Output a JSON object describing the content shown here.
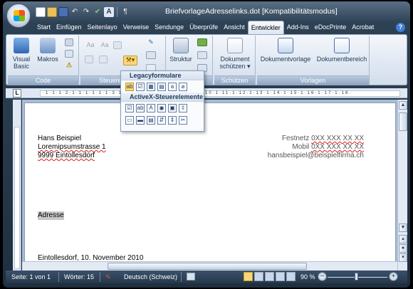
{
  "window": {
    "title": "BriefvorlageAdresselinks.dot [Kompatibilitätsmodus]"
  },
  "quick_access": {
    "icons": [
      "new-document-icon",
      "open-folder-icon",
      "save-icon",
      "undo-icon",
      "redo-icon",
      "check-mark-icon",
      "font-icon",
      "paragraph-marks-icon"
    ],
    "undo_glyph": "↶",
    "redo_glyph": "↷",
    "paragraph_glyph": "¶"
  },
  "ribbon_tabs": [
    "Start",
    "Einfügen",
    "Seitenlayo",
    "Verweise",
    "Sendunge",
    "Überprüfe",
    "Ansicht",
    "Entwickler",
    "Add-Ins",
    "eDocPrinte",
    "Acrobat"
  ],
  "active_tab": "Entwickler",
  "help_glyph": "?",
  "groups": {
    "code": {
      "label": "Code",
      "visual_basic": "Visual\nBasic",
      "makros": "Makros"
    },
    "steuerelemente": {
      "label": "Steuere",
      "small_icon_letters": [
        "Aa",
        "Aa"
      ]
    },
    "xml": {
      "struktur": "Struktur"
    },
    "schuetzen": {
      "label": "Schützen",
      "dokument": "Dokument",
      "schuetzen": "schützen ▾"
    },
    "vorlagen": {
      "label": "Vorlagen",
      "dokumentvorlage": "Dokumentvorlage",
      "dokumentbereich": "Dokumentbereich"
    }
  },
  "popup": {
    "legacy_title": "Legacyformulare",
    "legacy_icons": [
      "ab",
      "☑",
      "▦",
      "▤",
      "a",
      "⌀"
    ],
    "activex_title": "ActiveX-Steuerelemente",
    "activex_row1": [
      "☑",
      "ab",
      "A",
      "◉",
      "▣",
      "⇳"
    ],
    "activex_row2": [
      "▭",
      "▬",
      "▤",
      "⇵",
      "⇕",
      "✂"
    ]
  },
  "ruler": {
    "corner": "L",
    "ticks": "·1·1·1·2·1·1·1·1·1·1·3·1·4·1·5·1·6·1·7·1·8·1·9·1·10·1·11·1·12·1·13·1·14·1·15·1·16·1·17·1·18·",
    "right_mark": "18"
  },
  "document": {
    "sender_name": "Hans Beispiel",
    "sender_street": "Loremipsumstrasse 1",
    "sender_city": "9999 Eintollesdorf",
    "festnetz_label": "Festnetz",
    "festnetz_value": "0XX XXX XX XX",
    "mobil_label": "Mobil",
    "mobil_value": "0XX XXX XX XX",
    "email": "hansbeispiel@beispielfirma.ch",
    "recipient": "Adresse",
    "date_line": "Eintollesdorf, 10. November 2010"
  },
  "status_bar": {
    "page": "Seite: 1 von 1",
    "words": "Wörter: 15",
    "language": "Deutsch (Schweiz)",
    "zoom": "90 %",
    "zoom_minus": "−",
    "zoom_plus": "+"
  },
  "colors": {
    "title_gradient_top": "#5a6f84",
    "ribbon": "#dfe7f2",
    "group_label": "#8fa6c2",
    "status_bar": "#2d4155",
    "spell_error": "#d62020",
    "selection_highlight": "#c8c8c8"
  }
}
